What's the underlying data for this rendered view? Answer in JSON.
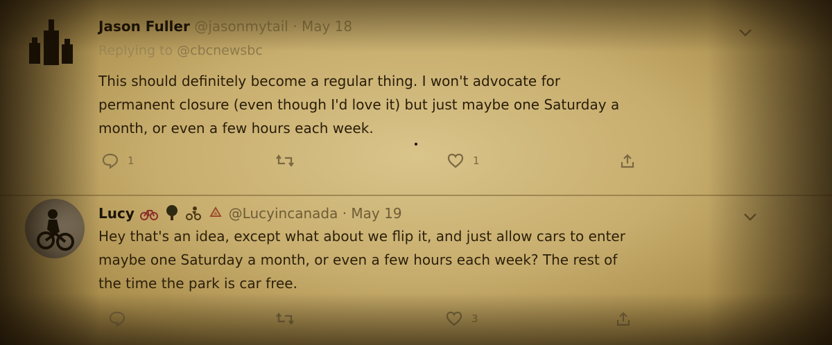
{
  "tweets": [
    {
      "author": "Jason Fuller",
      "handle": "@jasonmytail",
      "separator": "·",
      "date": "May 18",
      "replying_prefix": "Replying to",
      "replying_to": "@cbcnewsbc",
      "body_lines": [
        "This should definitely become a regular thing. I won't advocate for",
        "permanent closure (even though I'd love it) but just maybe one Saturday a",
        "month, or even a few hours each week."
      ],
      "reply_count": "1",
      "retweet_count": "",
      "like_count": "1",
      "avatar_icon": "bottles-avatar-icon"
    },
    {
      "author": "Lucy",
      "author_emojis": [
        "bicycle-emoji",
        "tree-emoji",
        "cyclist-emoji",
        "recycle-emoji"
      ],
      "handle": "@Lucyincanada",
      "separator": "·",
      "date": "May 19",
      "body_lines": [
        "Hey that's an idea, except what about we flip it, and just allow cars to enter",
        "maybe one Saturday a month, or even a few hours each week? The rest of",
        "the time the park is car free."
      ],
      "reply_count": "",
      "retweet_count": "",
      "like_count": "3",
      "avatar_icon": "cyclist-avatar-icon"
    }
  ],
  "icons": {
    "reply": "speech-bubble-icon",
    "retweet": "retweet-icon",
    "like": "heart-icon",
    "share": "share-icon",
    "menu": "chevron-down-icon"
  },
  "colors": {
    "paper": "#c9b06f",
    "text": "#281c09",
    "muted": "#8a7545"
  }
}
